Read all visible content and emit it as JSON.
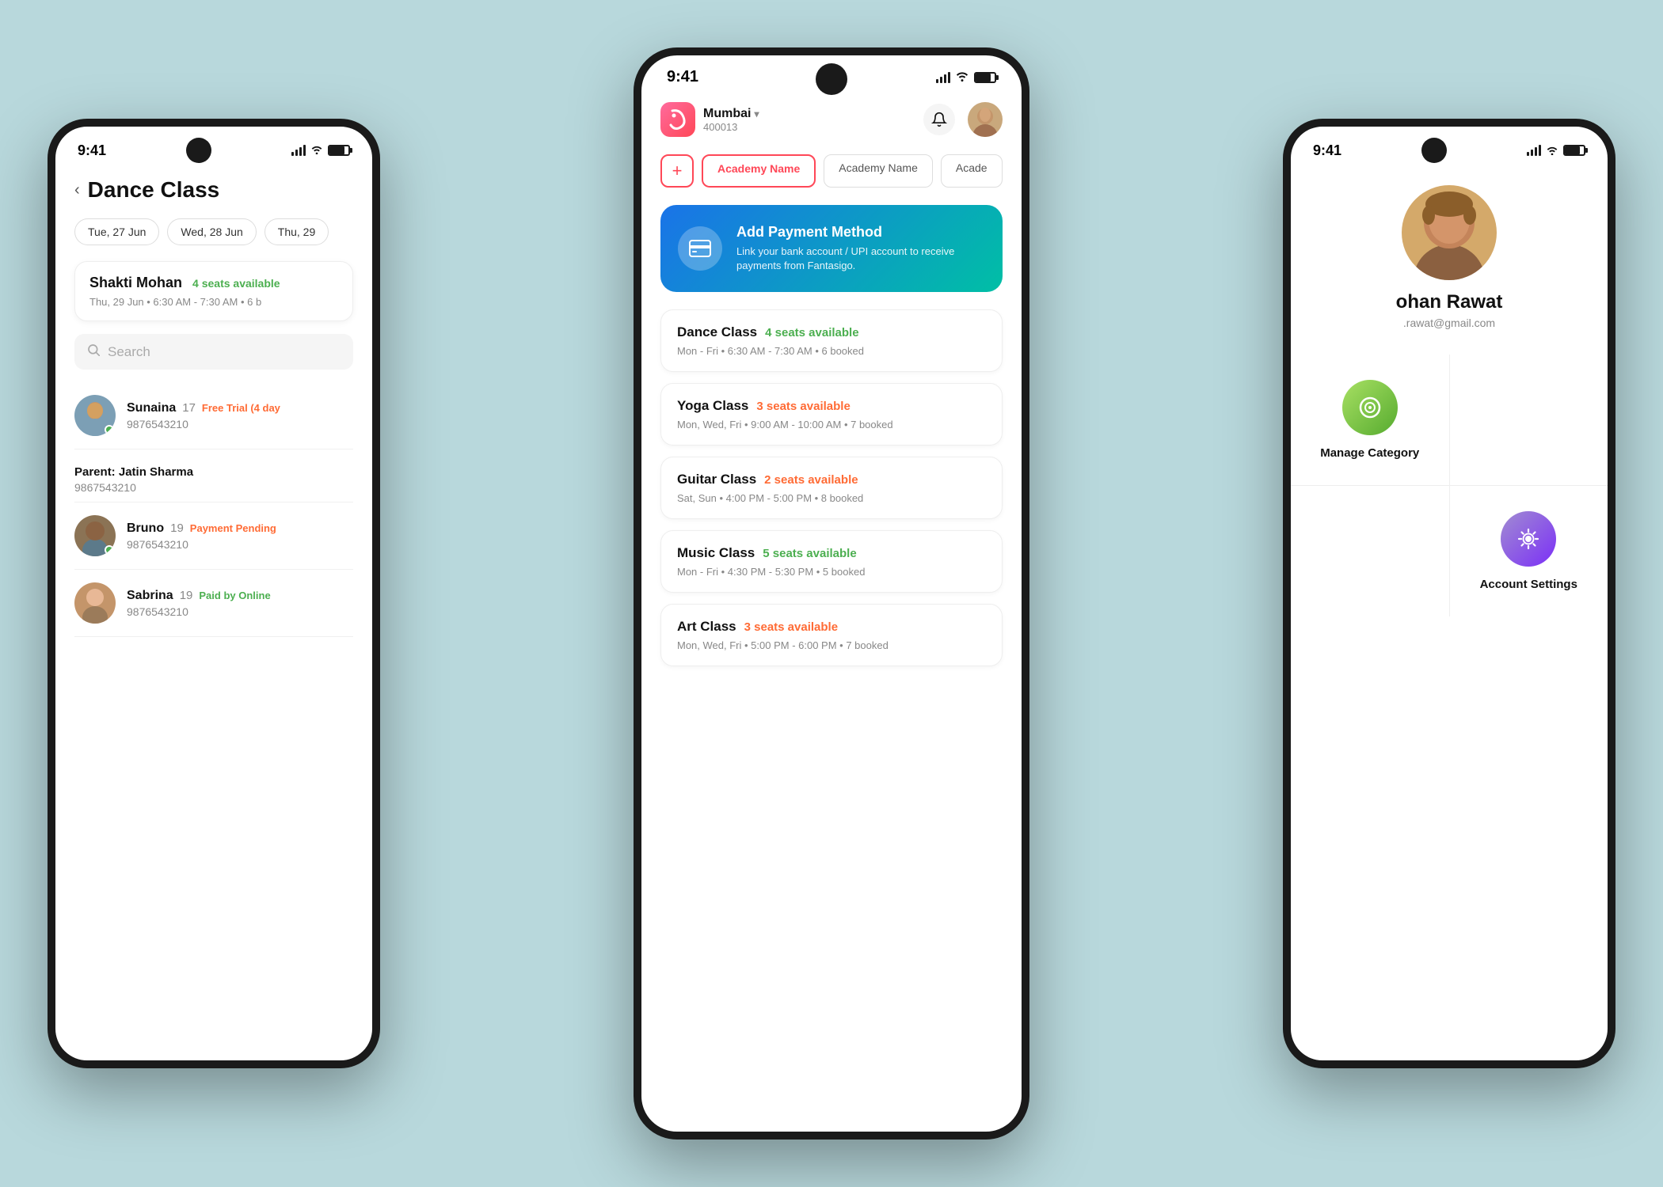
{
  "left_phone": {
    "time": "9:41",
    "page_title": "Dance Class",
    "back_label": "‹",
    "dates": [
      "Tue, 27 Jun",
      "Wed, 28 Jun",
      "Thu, 29"
    ],
    "class_card": {
      "name": "Shakti Mohan",
      "seats": "4 seats available",
      "meta": "Thu, 29 Jun  •  6:30 AM - 7:30 AM  •  6 b"
    },
    "search_placeholder": "Search",
    "students": [
      {
        "name": "Sunaina",
        "age": "17",
        "badge": "Free Trial (4 day",
        "badge_type": "free",
        "phone": "9876543210",
        "online": true
      },
      {
        "name": "Parent: Jatin Sharma",
        "phone": "9867543210",
        "is_parent": true
      },
      {
        "name": "Bruno",
        "age": "19",
        "badge": "Payment Pending",
        "badge_type": "pending",
        "phone": "9876543210",
        "online": true
      },
      {
        "name": "Sabrina",
        "age": "19",
        "badge": "Paid by Online",
        "badge_type": "paid",
        "phone": "9876543210",
        "online": false
      }
    ]
  },
  "center_phone": {
    "time": "9:41",
    "location": {
      "city": "Mumbai",
      "pincode": "400013"
    },
    "chips": {
      "add_label": "+",
      "items": [
        "Academy Name",
        "Academy Name",
        "Acade"
      ]
    },
    "payment_banner": {
      "title": "Add Payment Method",
      "description": "Link your bank account / UPI account to receive payments from Fantasigo."
    },
    "classes": [
      {
        "name": "Dance Class",
        "seats": "4 seats available",
        "seats_type": "green",
        "meta": "Mon - Fri  •  6:30 AM - 7:30 AM  •  6 booked"
      },
      {
        "name": "Yoga Class",
        "seats": "3 seats available",
        "seats_type": "orange",
        "meta": "Mon, Wed, Fri  •  9:00 AM - 10:00 AM  •  7 booked"
      },
      {
        "name": "Guitar Class",
        "seats": "2 seats available",
        "seats_type": "orange",
        "meta": "Sat, Sun  •  4:00 PM - 5:00 PM  •  8 booked"
      },
      {
        "name": "Music Class",
        "seats": "5 seats available",
        "seats_type": "green",
        "meta": "Mon - Fri  •  4:30 PM - 5:30 PM  •  5 booked"
      },
      {
        "name": "Art Class",
        "seats": "3 seats available",
        "seats_type": "orange",
        "meta": "Mon, Wed, Fri  •  5:00 PM - 6:00 PM  •  7 booked"
      }
    ]
  },
  "right_phone": {
    "time": "9:41",
    "profile": {
      "name": "ohan Rawat",
      "email": ".rawat@gmail.com"
    },
    "menu_items": [
      {
        "label": "Manage Category",
        "icon": "🎯",
        "icon_type": "green"
      },
      {
        "label": "",
        "icon": "",
        "icon_type": "blue"
      },
      {
        "label": "Account Settings",
        "icon": "⚙️",
        "icon_type": "purple"
      },
      {
        "label": "",
        "icon": "",
        "icon_type": "blue"
      }
    ]
  },
  "icons": {
    "bell": "🔔",
    "credit_card": "💳",
    "target": "🎯",
    "gear": "⚙️",
    "back": "‹"
  }
}
